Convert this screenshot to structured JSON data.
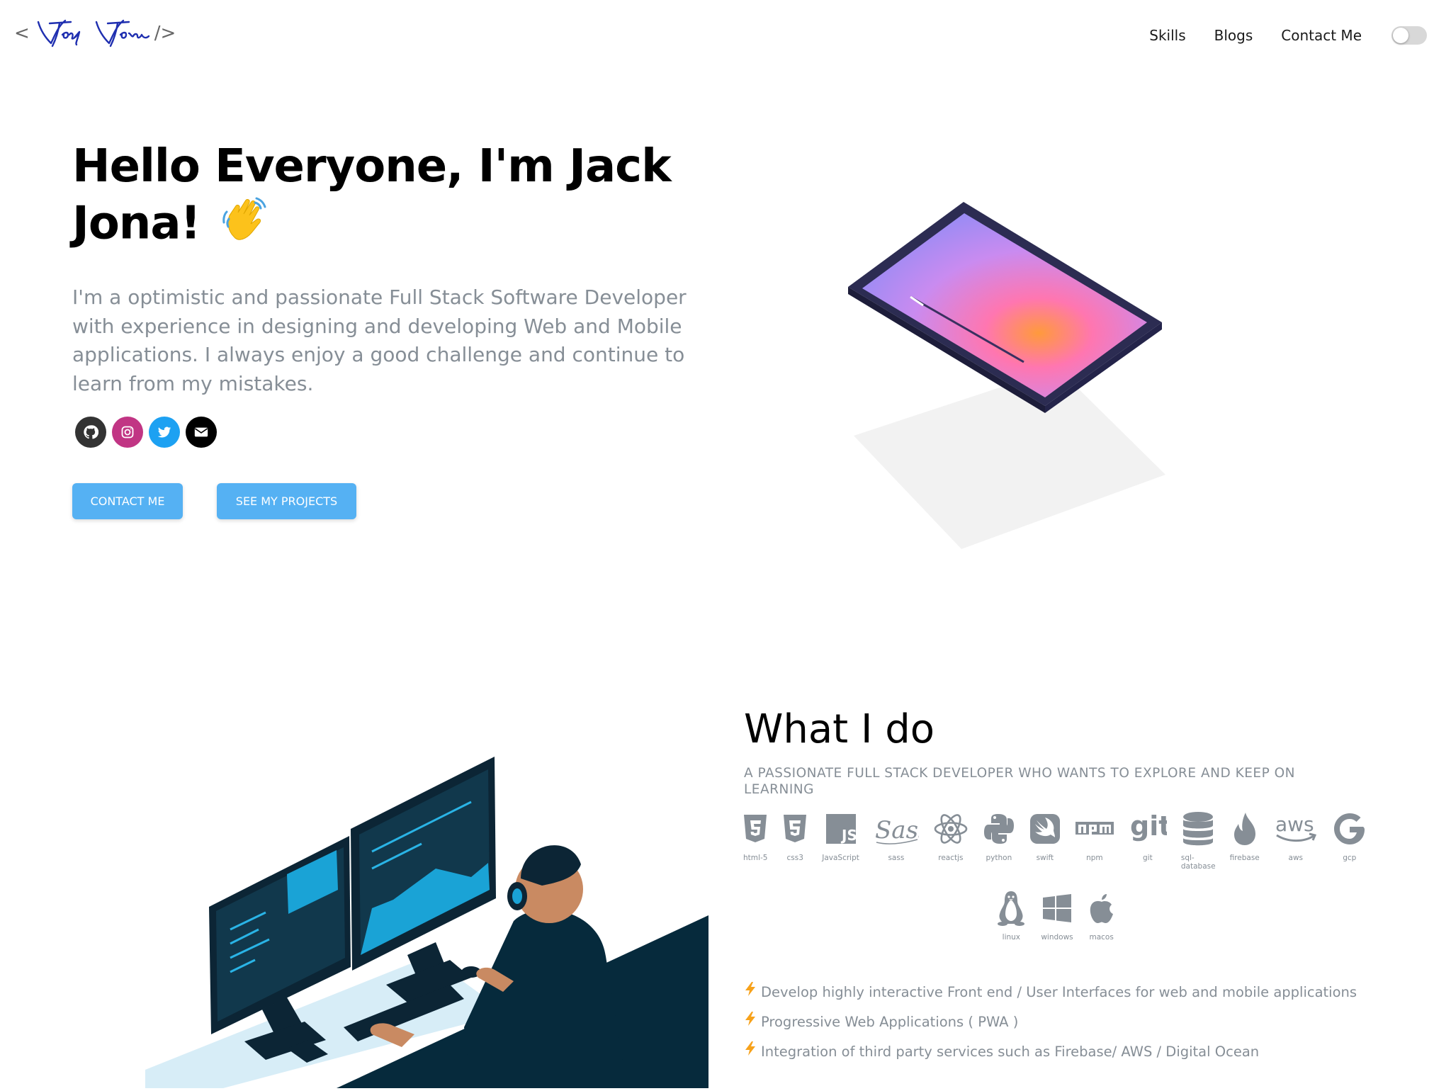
{
  "logo": {
    "open_bracket": "<",
    "close_bracket": "/>",
    "signature_text": "Jack Jona"
  },
  "nav": {
    "items": [
      "Skills",
      "Blogs",
      "Contact Me"
    ],
    "theme_toggle": "off"
  },
  "hero": {
    "title": "Hello Everyone, I'm Jack Jona!",
    "subtitle": "I'm a optimistic and passionate Full Stack Software Developer with experience in designing and developing Web and Mobile applications. I always enjoy a good challenge and continue to learn from my mistakes.",
    "socials": [
      {
        "icon": "github-icon",
        "color": "#333333"
      },
      {
        "icon": "instagram-icon",
        "color": "#c13584"
      },
      {
        "icon": "twitter-icon",
        "color": "#1da1f2"
      },
      {
        "icon": "email-icon",
        "color": "#000000"
      }
    ],
    "buttons": {
      "contact": "CONTACT ME",
      "projects": "SEE MY PROJECTS"
    }
  },
  "what_i_do": {
    "title": "What I do",
    "subtitle": "A PASSIONATE FULL STACK DEVELOPER WHO WANTS TO EXPLORE AND KEEP ON LEARNING",
    "skills": [
      "html-5",
      "css3",
      "JavaScript",
      "sass",
      "reactjs",
      "python",
      "swift",
      "npm",
      "git",
      "sql-database",
      "firebase",
      "aws",
      "gcp",
      "linux",
      "windows",
      "macos"
    ],
    "bullets": [
      "Develop highly interactive Front end / User Interfaces for web and mobile applications",
      "Progressive Web Applications ( PWA )",
      "Integration of third party services such as Firebase/ AWS / Digital Ocean"
    ]
  },
  "colors": {
    "accent": "#55b1f3",
    "muted_text": "#868e96",
    "icon_gray": "#868e96",
    "dark_navy": "#062a3c"
  }
}
